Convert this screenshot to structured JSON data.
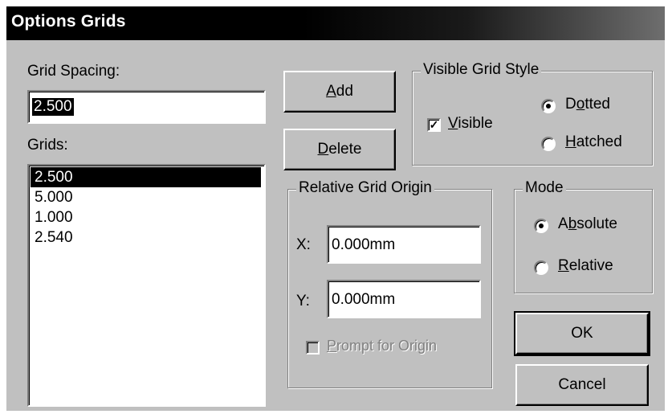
{
  "window": {
    "title": "Options Grids"
  },
  "grid_spacing": {
    "label": "Grid Spacing:",
    "value": "2.500"
  },
  "grids": {
    "label": "Grids:",
    "items": [
      "2.500",
      "5.000",
      "1.000",
      "2.540"
    ],
    "selected_index": 0
  },
  "buttons": {
    "add": {
      "accel": "A",
      "rest": "dd"
    },
    "delete": {
      "accel": "D",
      "rest": "elete"
    },
    "ok": "OK",
    "cancel": "Cancel"
  },
  "visible_grid_style": {
    "legend": "Visible Grid Style",
    "visible": {
      "accel": "V",
      "rest": "isible",
      "checked": true
    },
    "dotted": {
      "pre": "D",
      "accel": "o",
      "rest": "tted",
      "selected": true
    },
    "hatched": {
      "accel": "H",
      "rest": "atched",
      "selected": false
    }
  },
  "relative_grid_origin": {
    "legend": "Relative Grid Origin",
    "x_label": "X:",
    "x_value": "0.000mm",
    "y_label": "Y:",
    "y_value": "0.000mm",
    "prompt": {
      "accel": "P",
      "rest": "rompt for Origin",
      "checked": false,
      "enabled": false
    }
  },
  "mode": {
    "legend": "Mode",
    "absolute": {
      "pre": "A",
      "accel": "b",
      "rest": "solute",
      "selected": true
    },
    "relative": {
      "accel": "R",
      "rest": "elative",
      "selected": false
    }
  }
}
